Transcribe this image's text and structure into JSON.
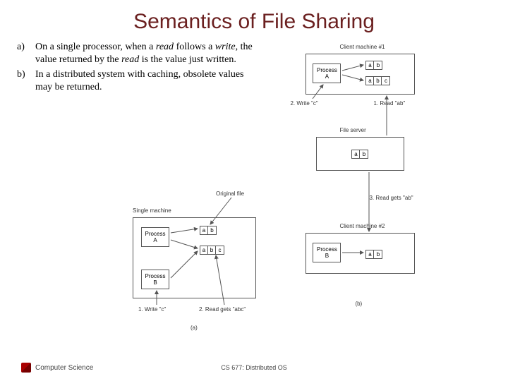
{
  "title": "Semantics of File Sharing",
  "items": [
    {
      "marker": "a)",
      "html": "On a single processor, when a <i>read</i> follows a <i>write</i>, the value returned by the <i>read</i> is the value just written."
    },
    {
      "marker": "b)",
      "html": "In a distributed system with caching, obsolete values may be returned."
    }
  ],
  "diagA": {
    "originalFile": "Original file",
    "singleMachine": "Single machine",
    "processA": "Process\nA",
    "processB": "Process\nB",
    "rowAB": [
      "a",
      "b"
    ],
    "rowABC": [
      "a",
      "b",
      "c"
    ],
    "write": "1. Write \"c\"",
    "read": "2. Read gets \"abc\"",
    "caption": "(a)"
  },
  "diagB": {
    "client1": "Client machine #1",
    "client2": "Client machine #2",
    "fileServer": "File server",
    "processA": "Process\nA",
    "processB": "Process\nB",
    "rowAB": [
      "a",
      "b"
    ],
    "rowABC": [
      "a",
      "b",
      "c"
    ],
    "writeC": "2. Write \"c\"",
    "readAB1": "1. Read \"ab\"",
    "readAB2": "3. Read gets \"ab\"",
    "caption": "(b)"
  },
  "footer": {
    "left": "Computer Science",
    "center": "CS 677: Distributed OS"
  }
}
